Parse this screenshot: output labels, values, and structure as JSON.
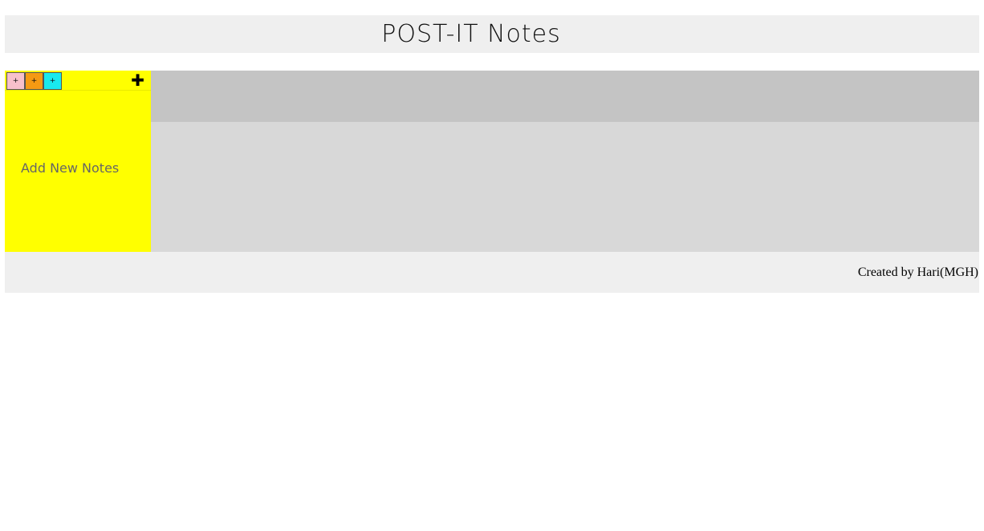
{
  "header": {
    "title": "POST-IT Notes"
  },
  "note": {
    "placeholder": "Add New Notes",
    "background_color": "#ffff00",
    "color_buttons": [
      {
        "label": "+",
        "color": "#f7c0cb",
        "name": "pink"
      },
      {
        "label": "+",
        "color": "#f59a13",
        "name": "orange"
      },
      {
        "label": "+",
        "color": "#19e9ee",
        "name": "cyan"
      }
    ],
    "add_button_icon": "plus-icon",
    "add_button_label": "✚"
  },
  "footer": {
    "credit": "Created by Hari(MGH)"
  },
  "colors": {
    "header_bg": "#efefef",
    "board_bg": "#d8d8d8",
    "board_top_bg": "#c4c4c4",
    "note_bg": "#ffff00"
  }
}
